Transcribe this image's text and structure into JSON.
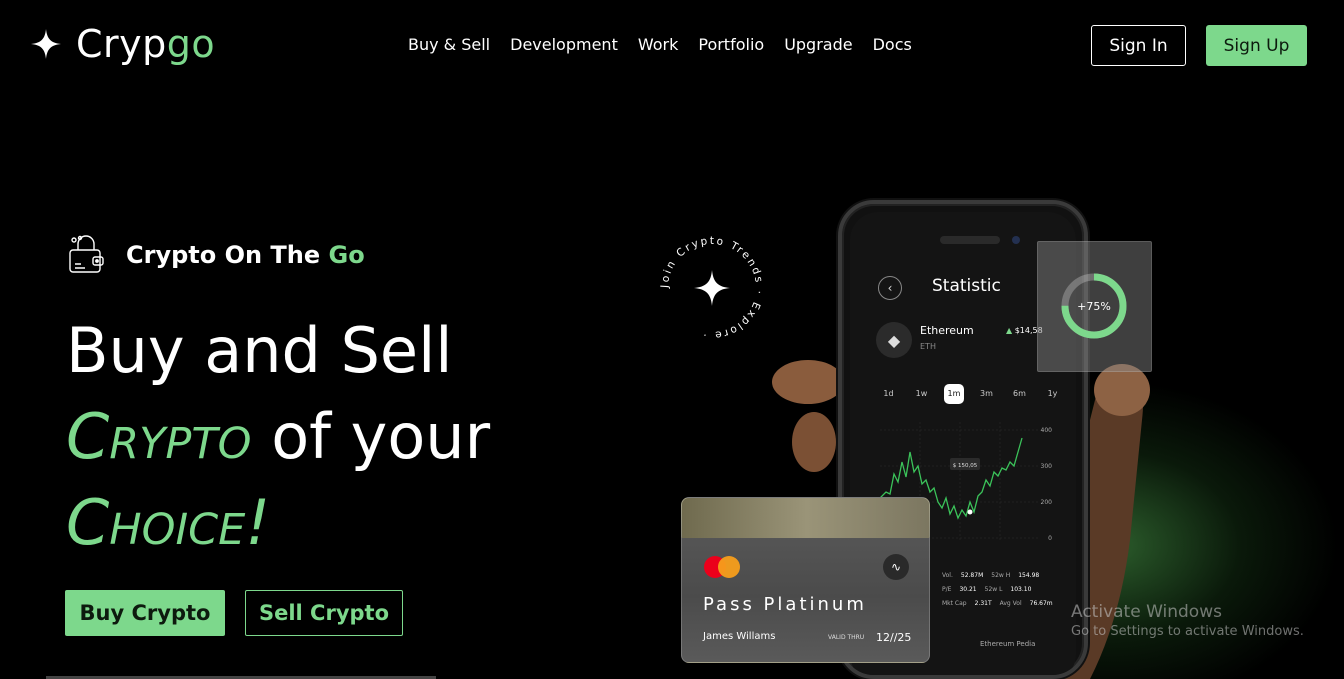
{
  "brand": {
    "name_part1": "Cryp",
    "name_part2": "go"
  },
  "nav": {
    "items": [
      "Buy & Sell",
      "Development",
      "Work",
      "Portfolio",
      "Upgrade",
      "Docs"
    ],
    "signin_label": "Sign In",
    "signup_label": "Sign Up"
  },
  "hero": {
    "tagline_part1": "Crypto On The ",
    "tagline_part2": "Go",
    "headline_line1": "Buy and Sell",
    "headline_crypto": "Crypto",
    "headline_of_your": " of your",
    "headline_choice": "Choice!",
    "buy_label": "Buy Crypto",
    "sell_label": "Sell Crypto"
  },
  "badge": {
    "circle_text": "Join Crypto Trends · Explore ·"
  },
  "phone": {
    "title": "Statistic",
    "coin_name": "Ethereum",
    "coin_symbol": "ETH",
    "coin_price": "$14,58",
    "price_change": "▲",
    "ranges": [
      "1d",
      "1w",
      "1m",
      "3m",
      "6m",
      "1y"
    ],
    "active_range": "1m",
    "price_tag": "$ 150,05",
    "y_ticks": [
      "400",
      "300",
      "200",
      "0"
    ],
    "stats": [
      {
        "k1": "Vol.",
        "v1": "52.87M",
        "k2": "52w H",
        "v2": "154.98"
      },
      {
        "k1": "P/E",
        "v1": "30.21",
        "k2": "52w L",
        "v2": "103.10"
      },
      {
        "k1": "Mkt Cap",
        "v1": "2.31T",
        "k2": "Avg Vol",
        "v2": "76.67m"
      }
    ],
    "footer": "Ethereum Pedia"
  },
  "ring": {
    "label": "+75%",
    "fraction": 0.75
  },
  "card": {
    "name": "Pass Platinum",
    "holder": "James Willams",
    "valid_label": "VALID THRU",
    "valid_value": "12//25"
  },
  "watermark": {
    "line1": "Activate Windows",
    "line2": "Go to Settings to activate Windows."
  },
  "colors": {
    "accent": "#7dd88c",
    "background": "#000000"
  },
  "icons": [
    "sparkle-star-icon",
    "wallet-lock-icon",
    "chevron-left-icon",
    "ethereum-icon",
    "contactless-icon",
    "mastercard-logo"
  ]
}
